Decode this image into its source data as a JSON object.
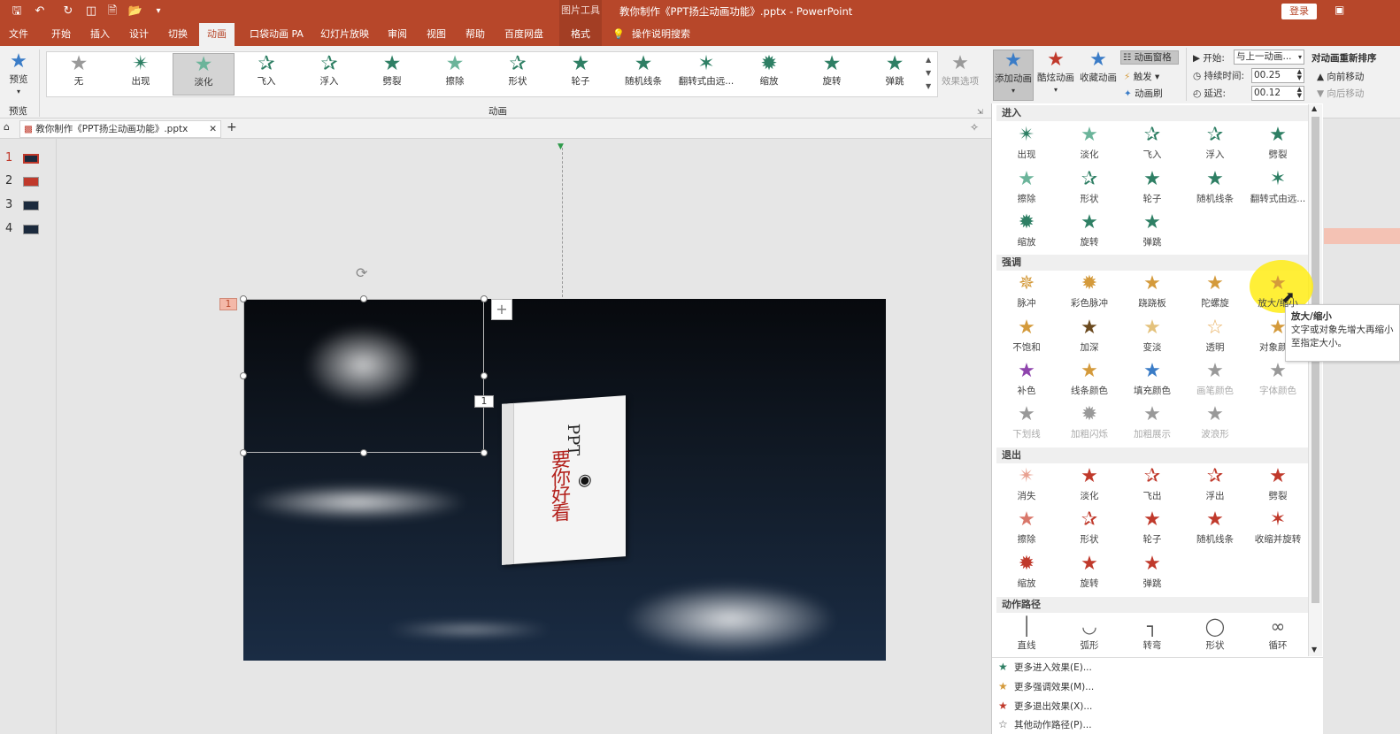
{
  "titlebar": {
    "contextual_tab": "图片工具",
    "window_title": "教你制作《PPT扬尘动画功能》.pptx - PowerPoint",
    "login": "登录"
  },
  "tabs": [
    "文件",
    "开始",
    "插入",
    "设计",
    "切换",
    "动画",
    "口袋动画 PA",
    "幻灯片放映",
    "审阅",
    "视图",
    "帮助",
    "百度网盘",
    "格式"
  ],
  "search_hint": "操作说明搜索",
  "ribbon": {
    "preview": "预览",
    "preview_group": "预览",
    "animation_group": "动画",
    "gallery": [
      "无",
      "出现",
      "淡化",
      "飞入",
      "浮入",
      "劈裂",
      "擦除",
      "形状",
      "轮子",
      "随机线条",
      "翻转式由远...",
      "缩放",
      "旋转",
      "弹跳"
    ],
    "effect_options": "效果选项",
    "add_animation": "添加动画",
    "cool_animation": "酷炫动画",
    "fav_animation": "收藏动画",
    "anim_pane": "动画窗格",
    "trigger": "触发",
    "anim_brush": "动画刷",
    "start_label": "开始:",
    "start_value": "与上一动画...",
    "duration_label": "持续时间:",
    "duration_value": "00.25",
    "delay_label": "延迟:",
    "delay_value": "00.12",
    "reorder": "对动画重新排序",
    "move_earlier": "向前移动",
    "move_later": "向后移动"
  },
  "doc_tab": "教你制作《PPT扬尘动画功能》.pptx",
  "slides": [
    "1",
    "2",
    "3",
    "4"
  ],
  "slide": {
    "anim_tag": "1",
    "anim_tag2": "1",
    "book_title": "PPT",
    "book_subtitle": "要你好看"
  },
  "pane": {
    "enter_title": "进入",
    "enter": [
      "出现",
      "淡化",
      "飞入",
      "浮入",
      "劈裂",
      "擦除",
      "形状",
      "轮子",
      "随机线条",
      "翻转式由远...",
      "缩放",
      "旋转",
      "弹跳"
    ],
    "emphasis_title": "强调",
    "emphasis": [
      "脉冲",
      "彩色脉冲",
      "跷跷板",
      "陀螺旋",
      "放大/缩小",
      "不饱和",
      "加深",
      "变淡",
      "透明",
      "对象颜色",
      "补色",
      "线条颜色",
      "填充颜色",
      "画笔颜色",
      "字体颜色",
      "下划线",
      "加粗闪烁",
      "加粗展示",
      "波浪形"
    ],
    "exit_title": "退出",
    "exit": [
      "消失",
      "淡化",
      "飞出",
      "浮出",
      "劈裂",
      "擦除",
      "形状",
      "轮子",
      "随机线条",
      "收缩并旋转",
      "缩放",
      "旋转",
      "弹跳"
    ],
    "path_title": "动作路径",
    "paths": [
      "直线",
      "弧形",
      "转弯",
      "形状",
      "循环"
    ],
    "more": [
      "更多进入效果(E)...",
      "更多强调效果(M)...",
      "更多退出效果(X)...",
      "其他动作路径(P)..."
    ]
  },
  "tooltip": {
    "title": "放大/缩小",
    "body": "文字或对象先增大再缩小至指定大小。"
  }
}
